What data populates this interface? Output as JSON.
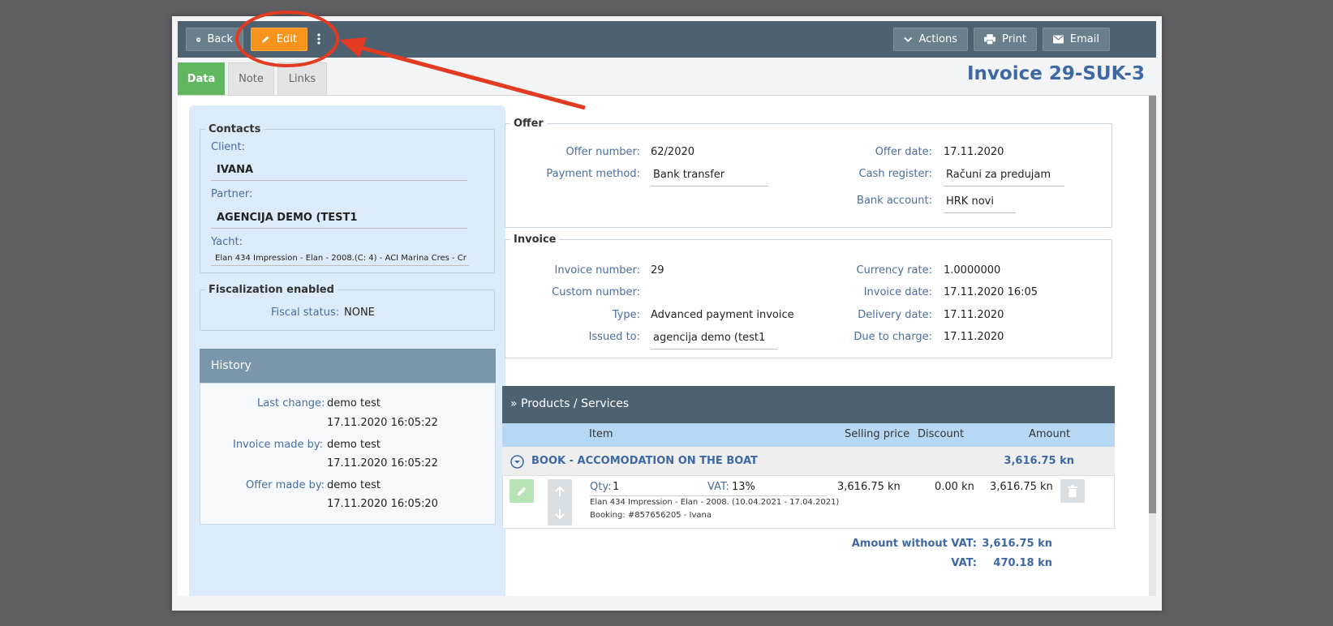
{
  "toolbar": {
    "back_label": "Back",
    "edit_label": "Edit",
    "actions_label": "Actions",
    "print_label": "Print",
    "email_label": "Email"
  },
  "tabs": [
    {
      "label": "Data"
    },
    {
      "label": "Note"
    },
    {
      "label": "Links"
    }
  ],
  "title": "Invoice 29-SUK-3",
  "contacts": {
    "legend": "Contacts",
    "client_label": "Client:",
    "client_value": "IVANA",
    "partner_label": "Partner:",
    "partner_value": "AGENCIJA DEMO (TEST1",
    "yacht_label": "Yacht:",
    "yacht_value": "Elan 434 Impression - Elan - 2008.(C: 4) - ACI Marina Cres - Cr"
  },
  "fiscal": {
    "legend": "Fiscalization enabled",
    "status_label": "Fiscal status:",
    "status_value": "NONE"
  },
  "history": {
    "title": "History",
    "last_change_label": "Last change:",
    "last_change_user": "demo test",
    "last_change_date": "17.11.2020 16:05:22",
    "invoice_made_label": "Invoice made by:",
    "invoice_made_user": "demo test",
    "invoice_made_date": "17.11.2020 16:05:22",
    "offer_made_label": "Offer made by:",
    "offer_made_user": "demo test",
    "offer_made_date": "17.11.2020 16:05:20"
  },
  "offer": {
    "legend": "Offer",
    "number_label": "Offer number:",
    "number_value": "62/2020",
    "payment_label": "Payment method:",
    "payment_value": "Bank transfer",
    "date_label": "Offer date:",
    "date_value": "17.11.2020",
    "cash_label": "Cash register:",
    "cash_value": "Računi za predujam",
    "bank_label": "Bank account:",
    "bank_value": "HRK novi"
  },
  "invoice": {
    "legend": "Invoice",
    "number_label": "Invoice number:",
    "number_value": "29",
    "custom_label": "Custom number:",
    "type_label": "Type:",
    "type_value": "Advanced payment invoice",
    "issued_label": "Issued to:",
    "issued_value": "agencija demo (test1",
    "rate_label": "Currency rate:",
    "rate_value": "1.0000000",
    "date_label": "Invoice date:",
    "date_value": "17.11.2020 16:05",
    "delivery_label": "Delivery date:",
    "delivery_value": "17.11.2020",
    "due_label": "Due to charge:",
    "due_value": "17.11.2020"
  },
  "products": {
    "title": "» Products / Services",
    "col_item": "Item",
    "col_price": "Selling price",
    "col_discount": "Discount",
    "col_amount": "Amount",
    "group_name": "BOOK - ACCOMODATION ON THE BOAT",
    "group_amount": "3,616.75 kn",
    "qty_label": "Qty:",
    "qty_value": "1",
    "vat_label": "VAT:",
    "vat_value": "13%",
    "desc_line1": "Elan 434 Impression - Elan - 2008. (10.04.2021 - 17.04.2021)",
    "desc_line2": "Booking: #857656205 - Ivana",
    "price": "3,616.75 kn",
    "discount": "0.00 kn",
    "amount": "3,616.75 kn"
  },
  "totals": {
    "without_vat_label": "Amount without VAT:",
    "without_vat_value": "3,616.75 kn",
    "vat_label": "VAT:",
    "vat_value": "470.18 kn"
  },
  "colors": {
    "toolbar": "#4d6170",
    "edit_button": "#f7941d",
    "active_tab": "#5fb760",
    "title": "#3e68a3",
    "annotation": "#e23b22"
  }
}
